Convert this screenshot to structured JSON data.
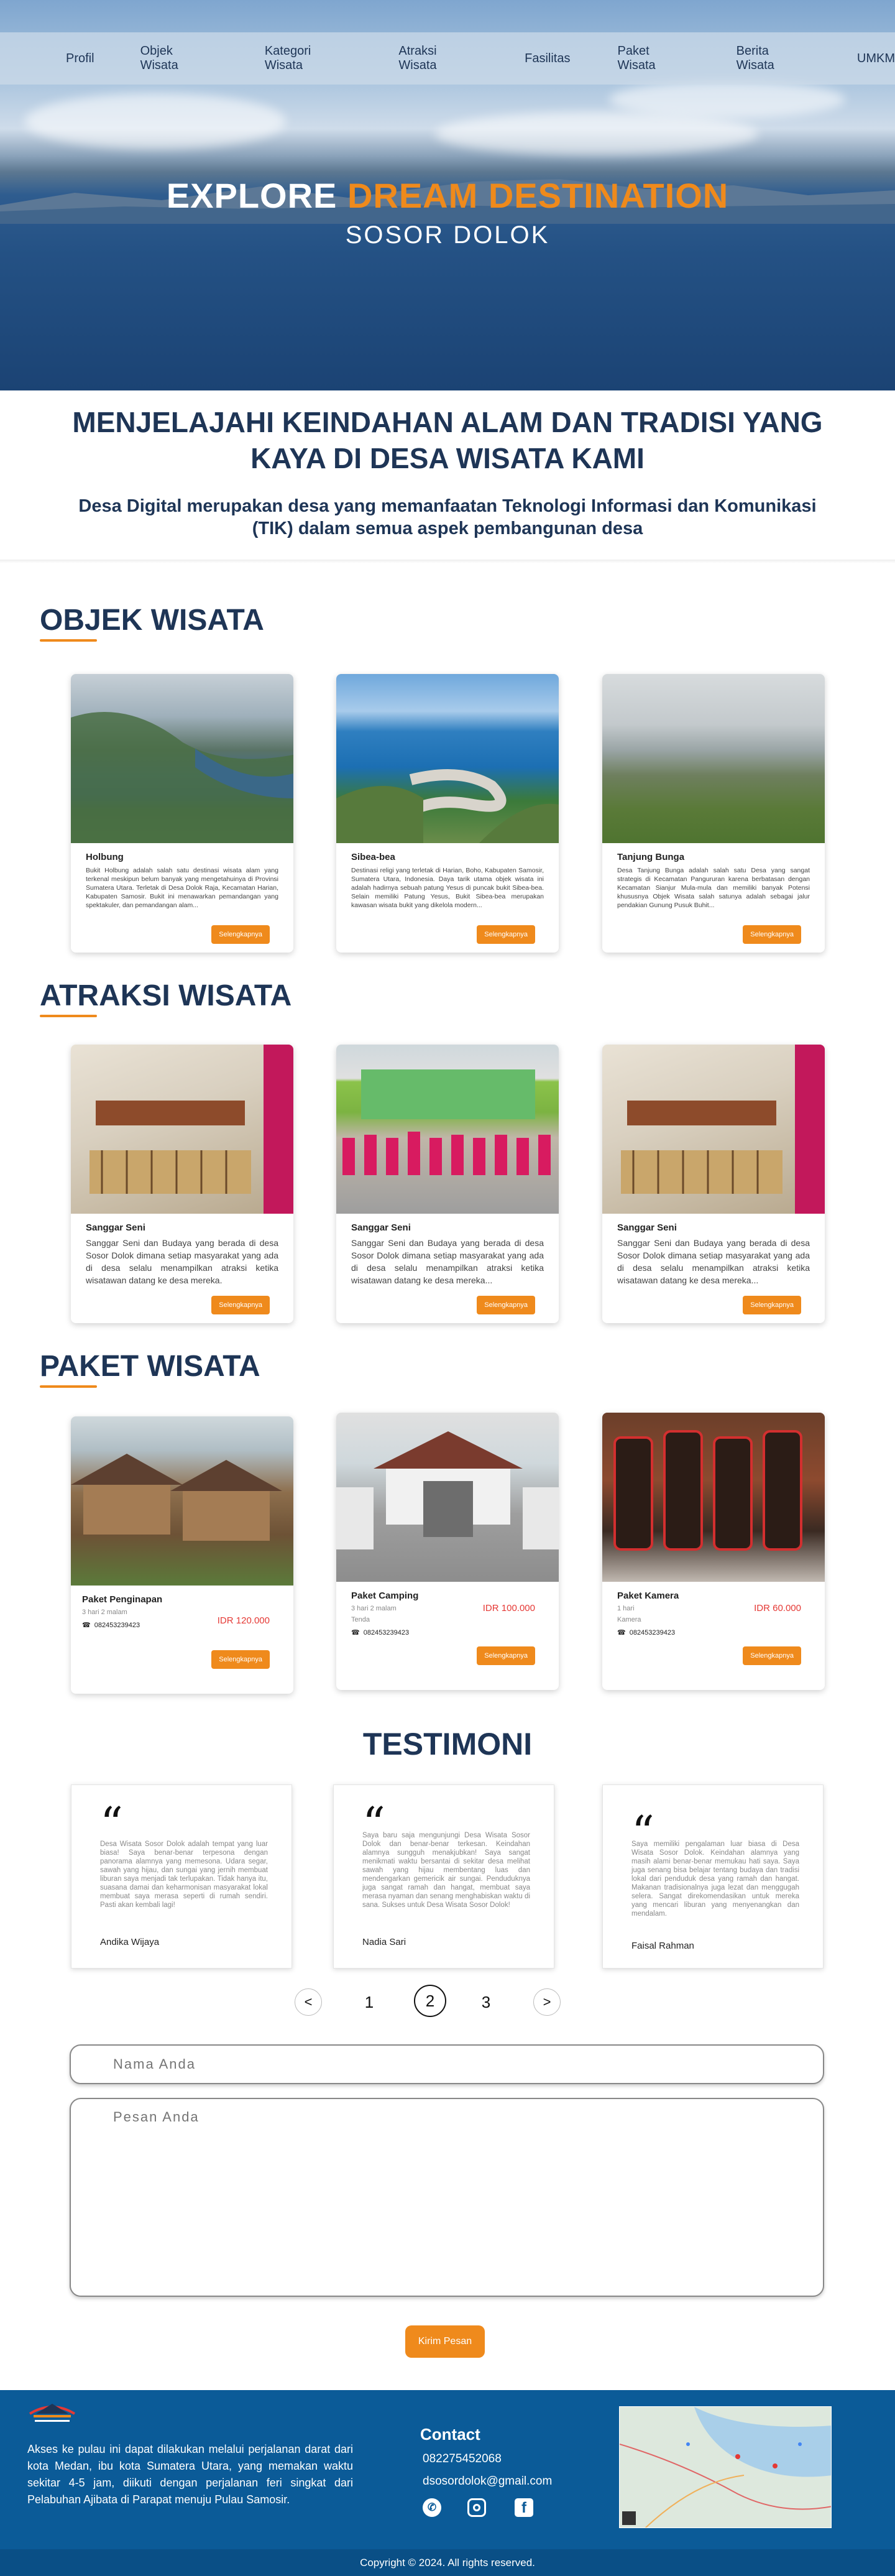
{
  "nav": [
    "Profil",
    "Objek Wisata",
    "Kategori Wisata",
    "Atraksi Wisata",
    "Fasilitas",
    "Paket Wisata",
    "Berita Wisata",
    "UMKM"
  ],
  "hero": {
    "title_white": "EXPLORE ",
    "title_orange": "DREAM DESTINATION",
    "subtitle": "SOSOR DOLOK"
  },
  "intro": {
    "heading": "MENJELAJAHI KEINDAHAN ALAM DAN TRADISI YANG KAYA DI DESA WISATA KAMI",
    "text": "Desa Digital merupakan desa yang memanfaatan Teknologi Informasi dan Komunikasi (TIK) dalam semua aspek pembangunan desa"
  },
  "objek": {
    "heading": "OBJEK WISATA",
    "cards": [
      {
        "title": "Holbung",
        "desc": "Bukit Holbung adalah salah satu destinasi wisata alam yang terkenal meskipun belum banyak yang mengetahuinya di Provinsi Sumatera Utara. Terletak di Desa Dolok Raja, Kecamatan Harian, Kabupaten Samosir. Bukit ini menawarkan pemandangan yang spektakuler, dan pemandangan alam...",
        "button": "Selengkapnya"
      },
      {
        "title": "Sibea-bea",
        "desc": "Destinasi religi yang terletak di Harian, Boho, Kabupaten Samosir, Sumatera Utara, Indonesia. Daya tarik utama objek wisata ini adalah hadirnya sebuah patung Yesus di puncak bukit Sibea-bea. Selain memiliki Patung Yesus, Bukit Sibea-bea merupakan kawasan wisata bukit yang dikelola modern...",
        "button": "Selengkapnya"
      },
      {
        "title": "Tanjung Bunga",
        "desc": "Desa Tanjung Bunga adalah salah satu Desa yang sangat strategis di Kecamatan Pangururan karena berbatasan dengan Kecamatan Sianjur Mula-mula dan memiliki banyak Potensi khususnya Objek Wisata salah satunya adalah sebagai jalur pendakian Gunung Pusuk Buhit...",
        "button": "Selengkapnya"
      }
    ]
  },
  "atraksi": {
    "heading": "ATRAKSI WISATA",
    "cards": [
      {
        "title": "Sanggar Seni",
        "desc": "Sanggar Seni dan Budaya yang berada di desa Sosor Dolok dimana setiap masyarakat yang ada di desa selalu menampilkan atraksi ketika wisatawan datang ke desa mereka.",
        "button": "Selengkapnya"
      },
      {
        "title": "Sanggar Seni",
        "desc": "Sanggar Seni dan Budaya yang berada di desa Sosor Dolok dimana setiap masyarakat yang ada di desa selalu menampilkan atraksi ketika wisatawan datang ke desa mereka...",
        "button": "Selengkapnya"
      },
      {
        "title": "Sanggar Seni",
        "desc": "Sanggar Seni dan Budaya yang berada di desa Sosor Dolok dimana setiap masyarakat yang ada di desa selalu menampilkan atraksi ketika wisatawan datang ke desa mereka...",
        "button": "Selengkapnya"
      }
    ]
  },
  "paket": {
    "heading": "PAKET WISATA",
    "cards": [
      {
        "title": "Paket Penginapan",
        "duration": "3 hari 2 malam",
        "price": "IDR 120.000",
        "phone": "082453239423",
        "button": "Selengkapnya"
      },
      {
        "title": "Paket Camping",
        "duration": "3 hari 2 malam",
        "extra": "Tenda",
        "price": "IDR 100.000",
        "phone": "082453239423",
        "button": "Selengkapnya"
      },
      {
        "title": "Paket Kamera",
        "duration": "1 hari",
        "extra": "Kamera",
        "price": "IDR 60.000",
        "phone": "082453239423",
        "button": "Selengkapnya"
      }
    ]
  },
  "testimoni": {
    "heading": "TESTIMONI",
    "items": [
      {
        "text": "Desa Wisata Sosor Dolok adalah tempat yang luar biasa! Saya benar-benar terpesona dengan panorama alamnya yang memesona. Udara segar, sawah yang hijau, dan sungai yang jernih membuat liburan saya menjadi tak terlupakan. Tidak hanya itu, suasana damai dan keharmonisan masyarakat lokal membuat saya merasa seperti di rumah sendiri. Pasti akan kembali lagi!",
        "name": "Andika Wijaya"
      },
      {
        "text": "Saya baru saja mengunjungi Desa Wisata Sosor Dolok dan benar-benar terkesan. Keindahan alamnya sungguh menakjubkan! Saya sangat menikmati waktu bersantai di sekitar desa melihat sawah yang hijau membentang luas dan mendengarkan gemericik air sungai. Penduduknya juga sangat ramah dan hangat, membuat saya merasa nyaman dan senang menghabiskan waktu di sana. Sukses untuk Desa Wisata Sosor Dolok!",
        "name": "Nadia Sari"
      },
      {
        "text": "Saya memiliki pengalaman luar biasa di Desa Wisata Sosor Dolok. Keindahan alamnya yang masih alami benar-benar memukau hati saya. Saya juga senang bisa belajar tentang budaya dan tradisi lokal dari penduduk desa yang ramah dan hangat. Makanan tradisionalnya juga lezat dan menggugah selera. Sangat direkomendasikan untuk mereka yang mencari liburan yang menyenangkan dan mendalam.",
        "name": "Faisal Rahman"
      }
    ],
    "pages": [
      "1",
      "2",
      "3"
    ],
    "prev": "<",
    "next": ">"
  },
  "form": {
    "name_placeholder": "Nama Anda",
    "message_placeholder": "Pesan Anda",
    "submit": "Kirim Pesan"
  },
  "footer": {
    "text": "Akses ke pulau ini dapat dilakukan melalui perjalanan darat dari kota Medan, ibu kota Sumatera Utara, yang memakan waktu sekitar 4-5 jam, diikuti dengan perjalanan feri singkat dari Pelabuhan Ajibata di Parapat menuju Pulau Samosir.",
    "contact_title": "Contact",
    "phone": "082275452068",
    "email": "dsosordolok@gmail.com",
    "copyright": "Copyright © 2024. All rights reserved."
  },
  "colors": {
    "navy": "#1e3556",
    "orange": "#ef8a1c",
    "footer": "#0b5b98",
    "price": "#e53935"
  }
}
